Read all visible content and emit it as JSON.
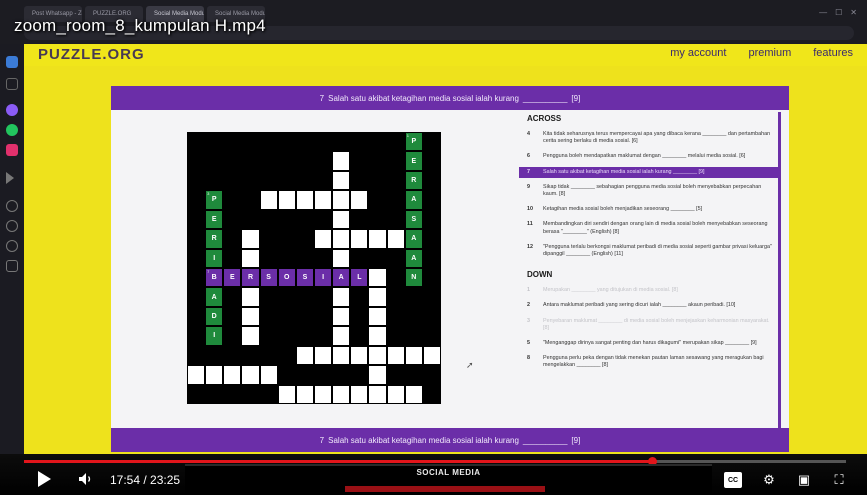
{
  "video": {
    "title": "zoom_room_8_kumpulan H.mp4",
    "time_current": "17:54",
    "time_total": "23:25",
    "progress": 0.764,
    "thumbnail_label": "SOCIAL MEDIA",
    "accent": "#e2151b"
  },
  "browser": {
    "tabs": [
      "Post Whatsapp - Zoom",
      "PUZZLE.ORG",
      "Social Media Module (PU…",
      "Social Media Module (Pu…"
    ]
  },
  "site": {
    "logo": "PUZZLE.ORG",
    "nav": [
      "my account",
      "premium",
      "features"
    ],
    "brand_color": "#f0e61a"
  },
  "puzzle": {
    "banner": {
      "number": "7",
      "clue": "Salah satu akibat ketagihan media sosial ialah kurang",
      "blank": "__________",
      "length": "[9]"
    },
    "colors": {
      "across_highlight": "#6b2ea8",
      "down_highlight": "#1f8a3c"
    },
    "across_heading": "ACROSS",
    "down_heading": "DOWN",
    "across": [
      {
        "num": "4",
        "text": "Kita tidak seharusnya terus mempercayai apa yang dibaca kerana ________ dan pertambahan cerita sering berlaku di media sosial. [6]",
        "state": "normal"
      },
      {
        "num": "6",
        "text": "Pengguna boleh mendapatkan maklumat dengan ________ melalui media sosial. [6]",
        "state": "normal"
      },
      {
        "num": "7",
        "text": "Salah satu akibat ketagihan media sosial ialah kurang ________ [9]",
        "state": "active"
      },
      {
        "num": "9",
        "text": "Sikap tidak ________ sebahagian pengguna media sosial boleh menyebabkan perpecahan kaum. [8]",
        "state": "normal"
      },
      {
        "num": "10",
        "text": "Ketagihan media sosial boleh menjadikan seseorang ________ [5]",
        "state": "normal"
      },
      {
        "num": "11",
        "text": "Membandingkan diri sendiri dengan orang lain di media sosial boleh menyebabkan seseorang berasa \"________\" (English) [8]",
        "state": "normal"
      },
      {
        "num": "12",
        "text": "\"Pengguna terlalu berkongsi maklumat peribadi di media sosial seperti gambar privasi keluarga\" dipanggil ________ (English) [11]",
        "state": "normal"
      }
    ],
    "down": [
      {
        "num": "1",
        "text": "Merupakan ________ yang ditujukan di media sosial. [8]",
        "state": "faded"
      },
      {
        "num": "2",
        "text": "Antara maklumat peribadi yang sering dicuri ialah ________ akaun peribadi. [10]",
        "state": "normal"
      },
      {
        "num": "3",
        "text": "Penyebaran maklumat ________ di media sosial boleh menjejaskan keharmonian masyarakat. [8]",
        "state": "faded"
      },
      {
        "num": "5",
        "text": "\"Menganggap dirinya sangat penting dan harus dikagumi\" merupakan sikap ________ [9]",
        "state": "normal"
      },
      {
        "num": "8",
        "text": "Pengguna perlu peka dengan tidak menekan pautan laman sesawang yang meragukan bagi mengelakkan ________ [8]",
        "state": "normal"
      }
    ],
    "grid": {
      "rows": 14,
      "cols": 14,
      "white": [
        [
          1,
          8
        ],
        [
          2,
          8
        ],
        [
          3,
          4
        ],
        [
          3,
          5
        ],
        [
          3,
          6
        ],
        [
          3,
          7
        ],
        [
          3,
          8
        ],
        [
          3,
          9
        ],
        [
          4,
          8
        ],
        [
          5,
          3
        ],
        [
          5,
          7
        ],
        [
          5,
          8
        ],
        [
          5,
          9
        ],
        [
          5,
          10
        ],
        [
          5,
          11
        ],
        [
          6,
          3
        ],
        [
          6,
          8
        ],
        [
          7,
          10
        ],
        [
          8,
          3
        ],
        [
          8,
          8
        ],
        [
          8,
          10
        ],
        [
          9,
          3
        ],
        [
          9,
          8
        ],
        [
          9,
          10
        ],
        [
          10,
          3
        ],
        [
          10,
          8
        ],
        [
          10,
          10
        ],
        [
          11,
          6
        ],
        [
          11,
          7
        ],
        [
          11,
          8
        ],
        [
          11,
          9
        ],
        [
          11,
          10
        ],
        [
          11,
          11
        ],
        [
          11,
          12
        ],
        [
          11,
          13
        ],
        [
          12,
          0
        ],
        [
          12,
          1
        ],
        [
          12,
          2
        ],
        [
          12,
          3
        ],
        [
          12,
          4
        ],
        [
          12,
          10
        ],
        [
          13,
          5
        ],
        [
          13,
          6
        ],
        [
          13,
          7
        ],
        [
          13,
          8
        ],
        [
          13,
          9
        ],
        [
          13,
          10
        ],
        [
          13,
          11
        ],
        [
          13,
          12
        ]
      ],
      "green": [
        {
          "r": 3,
          "c": 1,
          "ch": "P",
          "num": "3"
        },
        {
          "r": 4,
          "c": 1,
          "ch": "E"
        },
        {
          "r": 5,
          "c": 1,
          "ch": "R"
        },
        {
          "r": 6,
          "c": 1,
          "ch": "I"
        },
        {
          "r": 8,
          "c": 1,
          "ch": "A"
        },
        {
          "r": 9,
          "c": 1,
          "ch": "D"
        },
        {
          "r": 10,
          "c": 1,
          "ch": "I"
        },
        {
          "r": 0,
          "c": 12,
          "ch": "P",
          "num": "1"
        },
        {
          "r": 1,
          "c": 12,
          "ch": "E"
        },
        {
          "r": 2,
          "c": 12,
          "ch": "R"
        },
        {
          "r": 3,
          "c": 12,
          "ch": "A"
        },
        {
          "r": 4,
          "c": 12,
          "ch": "S"
        },
        {
          "r": 5,
          "c": 12,
          "ch": "A"
        },
        {
          "r": 6,
          "c": 12,
          "ch": "A"
        },
        {
          "r": 7,
          "c": 12,
          "ch": "N"
        }
      ],
      "purple": [
        {
          "r": 7,
          "c": 1,
          "ch": "B",
          "num": "7"
        },
        {
          "r": 7,
          "c": 2,
          "ch": "E"
        },
        {
          "r": 7,
          "c": 3,
          "ch": "R"
        },
        {
          "r": 7,
          "c": 4,
          "ch": "S"
        },
        {
          "r": 7,
          "c": 5,
          "ch": "O"
        },
        {
          "r": 7,
          "c": 6,
          "ch": "S"
        },
        {
          "r": 7,
          "c": 7,
          "ch": "I"
        },
        {
          "r": 7,
          "c": 8,
          "ch": "A"
        },
        {
          "r": 7,
          "c": 9,
          "ch": "L"
        }
      ]
    }
  }
}
